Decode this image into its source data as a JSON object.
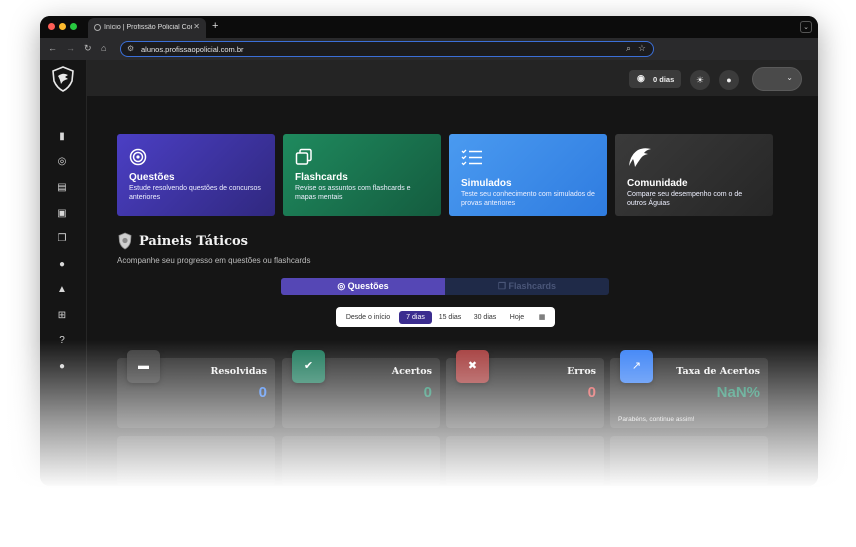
{
  "browser": {
    "tab_title": "Início | Profissão Policial Con...",
    "tab_close": "✕",
    "new_tab": "+",
    "url": "alunos.profissaopolicial.com.br",
    "menu_glyph": "⌄",
    "icons": [
      "back-icon",
      "forward-icon",
      "reload-icon",
      "home-icon",
      "tune-icon",
      "zoom-icon",
      "star-icon"
    ]
  },
  "header": {
    "streak_label": "0 dias",
    "icons": [
      "flame-icon",
      "sun-icon",
      "bell-icon",
      "chevron-down-icon"
    ]
  },
  "sidebar": {
    "icons": [
      "chart-icon",
      "target-icon",
      "clipboard-icon",
      "question-book-icon",
      "copy-icon",
      "users-icon",
      "graduation-icon",
      "cart-icon",
      "help-icon",
      "lightbulb-icon"
    ]
  },
  "cards": [
    {
      "title": "Questões",
      "description": "Estude resolvendo questões de concursos anteriores",
      "icon": "target-icon",
      "color_from": "#4b3fc4",
      "color_to": "#30287f"
    },
    {
      "title": "Flashcards",
      "description": "Revise os assuntos com flashcards e mapas mentais",
      "icon": "copy-icon",
      "color_from": "#1f8a5e",
      "color_to": "#145c3f"
    },
    {
      "title": "Simulados",
      "description": "Teste seu conhecimento com simulados de provas anteriores",
      "icon": "checklist-icon",
      "color_from": "#4a9af0",
      "color_to": "#2f7ce0"
    },
    {
      "title": "Comunidade",
      "description": "Compare seu desempenho com o de outros Águias",
      "icon": "eagle-icon",
      "color_from": "#3a3a3a",
      "color_to": "#262626"
    }
  ],
  "paineis": {
    "title": "Paineis Táticos",
    "subtitle": "Acompanhe seu progresso em questões ou flashcards",
    "seg_questoes": "◎ Questões",
    "seg_flashcards": "❐ Flashcards"
  },
  "filters": {
    "options": [
      "Desde o início",
      "7 dias",
      "15 dias",
      "30 dias",
      "Hoje"
    ],
    "selected": "7 dias",
    "calendar_icon": "calendar-icon"
  },
  "stats": [
    {
      "label": "Resolvidas",
      "value": "0",
      "color": "#3b82f6",
      "icon": "chat-icon",
      "icon_bg": "#3a3a3a",
      "footer": ""
    },
    {
      "label": "Acertos",
      "value": "0",
      "color": "#1f8a6a",
      "icon": "check-circle-icon",
      "icon_bg": "#1e7a5c",
      "footer": ""
    },
    {
      "label": "Erros",
      "value": "0",
      "color": "#e05252",
      "icon": "x-circle-icon",
      "icon_bg": "#a33a3a",
      "footer": ""
    },
    {
      "label": "Taxa de Acertos",
      "value": "NaN%",
      "color": "#1f8a6a",
      "icon": "trend-up-icon",
      "icon_bg": "#3b82f6",
      "footer": "Parabéns, continue assim!"
    }
  ]
}
